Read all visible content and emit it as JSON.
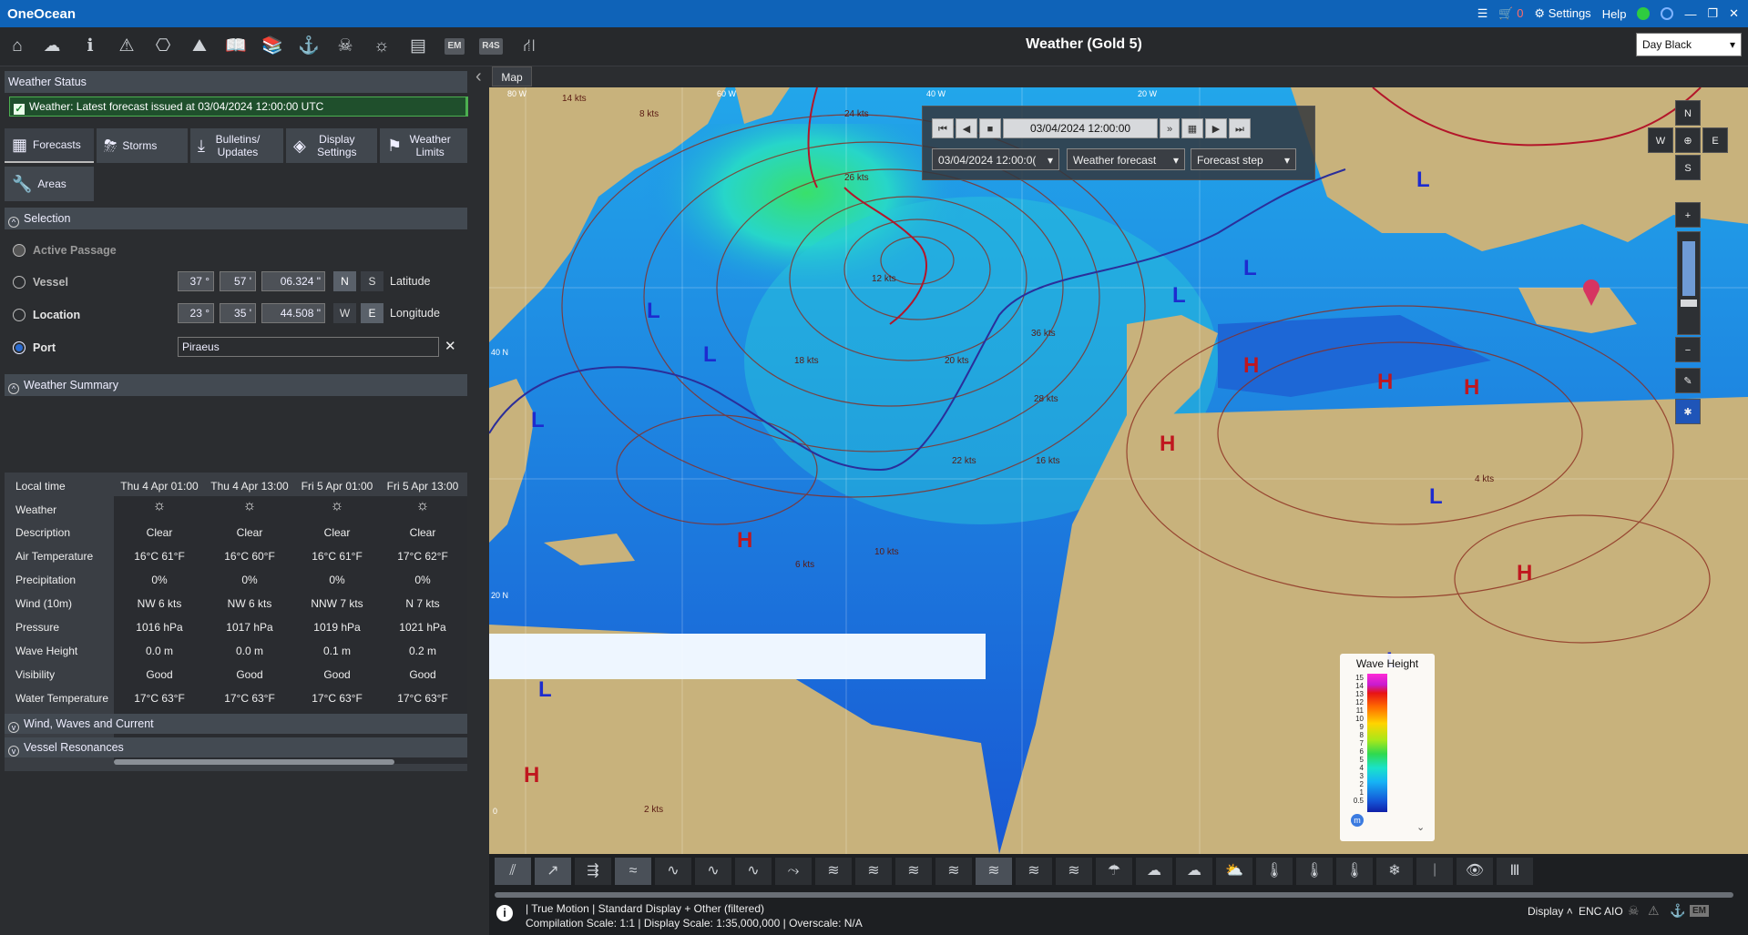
{
  "app": {
    "title": "OneOcean",
    "cart_count": "0",
    "settings_label": "Settings",
    "help_label": "Help"
  },
  "colors": {
    "titlebar": "#0f63b8",
    "status_green": "#4caf50",
    "front_red": "#b3162a",
    "front_blue": "#2b2e9a",
    "isobar": "#8b2b1e",
    "land": "#c8b27c"
  },
  "toolbar": {
    "page_title": "Weather (Gold 5)",
    "theme": "Day Black",
    "icons": [
      "home-icon",
      "cloud-upload-icon",
      "info-icon",
      "warning-icon",
      "route-icon",
      "chart-icon",
      "book-icon",
      "library-icon",
      "anchor-icon",
      "pirate-icon",
      "weather-icon",
      "news-icon",
      "em-icon",
      "r4s-icon",
      "user-plan-icon"
    ],
    "em_label": "EM",
    "r4s_label": "R4S"
  },
  "weather_status": {
    "header": "Weather Status",
    "message": "Weather: Latest forecast issued at 03/04/2024 12:00:00 UTC"
  },
  "tabs": [
    {
      "label": "Forecasts",
      "icon": "grid-icon"
    },
    {
      "label": "Storms",
      "icon": "storm-icon"
    },
    {
      "label": "Bulletins/ Updates",
      "icon": "download-icon"
    },
    {
      "label": "Display Settings",
      "icon": "layers-icon"
    },
    {
      "label": "Weather Limits",
      "icon": "flag-icon"
    },
    {
      "label": "Areas",
      "icon": "wrench-icon"
    }
  ],
  "selection": {
    "header": "Selection",
    "active_passage": "Active Passage",
    "vessel": "Vessel",
    "location": "Location",
    "port": "Port",
    "latitude": {
      "deg": "37 °",
      "min": "57 '",
      "sec": "06.324 \"",
      "n": "N",
      "s": "S",
      "label": "Latitude"
    },
    "longitude": {
      "deg": "23 °",
      "min": "35 '",
      "sec": "44.508 \"",
      "w": "W",
      "e": "E",
      "label": "Longitude"
    },
    "port_value": "Piraeus"
  },
  "summary": {
    "header": "Weather Summary",
    "row_labels": [
      "Local time",
      "Weather",
      "Description",
      "Air Temperature",
      "Precipitation",
      "Wind (10m)",
      "Pressure",
      "Wave Height",
      "Visibility",
      "Water Temperature"
    ],
    "columns": [
      {
        "time": "Thu 4 Apr  01:00",
        "description": "Clear",
        "air_temp": "16°C  61°F",
        "precip": "0%",
        "wind": "NW  6 kts",
        "pressure": "1016 hPa",
        "wave": "0.0 m",
        "visibility": "Good",
        "water_temp": "17°C  63°F"
      },
      {
        "time": "Thu 4 Apr  13:00",
        "description": "Clear",
        "air_temp": "16°C  60°F",
        "precip": "0%",
        "wind": "NW  6 kts",
        "pressure": "1017 hPa",
        "wave": "0.0 m",
        "visibility": "Good",
        "water_temp": "17°C  63°F"
      },
      {
        "time": "Fri 5 Apr  01:00",
        "description": "Clear",
        "air_temp": "16°C  61°F",
        "precip": "0%",
        "wind": "NNW  7 kts",
        "pressure": "1019 hPa",
        "wave": "0.1 m",
        "visibility": "Good",
        "water_temp": "17°C  63°F"
      },
      {
        "time": "Fri 5 Apr  13:00",
        "description": "Clear",
        "air_temp": "17°C  62°F",
        "precip": "0%",
        "wind": "N  7 kts",
        "pressure": "1021 hPa",
        "wave": "0.2 m",
        "visibility": "Good",
        "water_temp": "17°C  63°F"
      }
    ]
  },
  "collapsed": {
    "wind_waves": "Wind, Waves and Current",
    "resonances": "Vessel Resonances"
  },
  "map": {
    "tab_label": "Map",
    "playback": {
      "datetime": "03/04/2024 12:00:00",
      "date_select": "03/04/2024 12:00:0(",
      "product": "Weather forecast",
      "step": "Forecast step"
    },
    "compass": {
      "n": "N",
      "s": "S",
      "w": "W",
      "e": "E"
    },
    "pressure_labels": [
      "L",
      "L",
      "L",
      "L",
      "L",
      "L",
      "L",
      "L",
      "L",
      "H",
      "H",
      "H",
      "H",
      "H",
      "H",
      "H"
    ],
    "lat_labels": [
      "40 N",
      "20 N"
    ],
    "lon_labels": [
      "80 W",
      "60 W",
      "40 W",
      "20 W",
      "0"
    ],
    "wind_labels": [
      "14 kts",
      "8 kts",
      "24 kts",
      "12 kts",
      "26 kts",
      "20 kts",
      "18 kts",
      "16 kts",
      "10 kts",
      "6 kts",
      "28 kts",
      "36 kts",
      "22 kts",
      "4 kts",
      "2 kts"
    ],
    "legend": {
      "title": "Wave Height",
      "values": [
        "15",
        "14",
        "13",
        "12",
        "11",
        "10",
        "9",
        "8",
        "7",
        "6",
        "5",
        "4",
        "3",
        "2",
        "1",
        "0.5"
      ],
      "unit": "m"
    }
  },
  "bottom": {
    "status_line1": "| True Motion | Standard Display + Other (filtered)",
    "status_line2": "Compilation Scale: 1:1  | Display Scale: 1:35,000,000  | Overscale: N/A",
    "display": "Display",
    "enc": "ENC",
    "aio": "AIO",
    "em": "EM"
  }
}
